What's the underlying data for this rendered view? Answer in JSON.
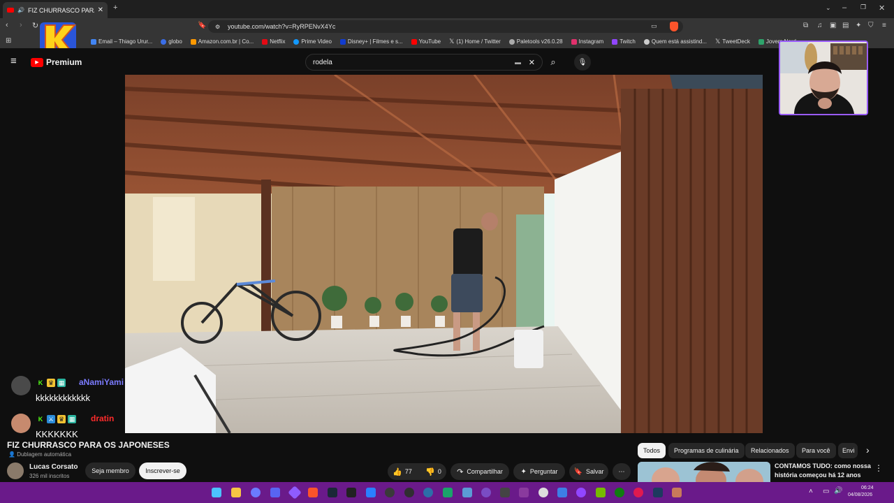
{
  "browser": {
    "tab_title": "FIZ CHURRASCO PARA OS JA",
    "url": "youtube.com/watch?v=RyRPENvX4Yc",
    "bookmarks": [
      {
        "label": "Email – Thiago Urur...",
        "color": "#4285f4"
      },
      {
        "label": "globo",
        "color": "#3a6ee8"
      },
      {
        "label": "Amazon.com.br | Co...",
        "color": "#ff9900"
      },
      {
        "label": "Netflix",
        "color": "#e50914"
      },
      {
        "label": "Prime Video",
        "color": "#1399ff"
      },
      {
        "label": "Disney+ | Filmes e s...",
        "color": "#113ccf"
      },
      {
        "label": "YouTube",
        "color": "#ff0000"
      },
      {
        "label": "(1) Home / Twitter",
        "color": "#ffffff"
      },
      {
        "label": "Paletools v26.0.28",
        "color": "#aaaaaa"
      },
      {
        "label": "Instagram",
        "color": "#e1306c"
      },
      {
        "label": "Twitch",
        "color": "#9146ff"
      },
      {
        "label": "Quem está assistind...",
        "color": "#cccccc"
      },
      {
        "label": "TweetDeck",
        "color": "#ffffff"
      },
      {
        "label": "Jovem Nerd -",
        "color": "#2ea36b"
      }
    ]
  },
  "youtube": {
    "logo_text": "Premium",
    "search_value": "rodela",
    "video": {
      "title": "FIZ CHURRASCO PARA OS JAPONESES",
      "dub_label": "Dublagem automática",
      "channel_name": "Lucas Corsato",
      "subscribers": "326 mil inscritos",
      "member_label": "Seja membro",
      "subscribe_label": "Inscrever-se",
      "likes": "77",
      "dislikes": "0",
      "share_label": "Compartilhar",
      "ask_label": "Perguntar",
      "save_label": "Salvar"
    },
    "chips": [
      "Todos",
      "Programas de culinária",
      "Relacionados",
      "Para você",
      "Envi"
    ],
    "recommended": {
      "title_line1": "CONTAMOS TUDO: como nossa",
      "title_line2": "história começou há 12 anos"
    }
  },
  "chat": [
    {
      "user": "aNamiYami",
      "message": "kkkkkkkkkkkk",
      "name_color": "#7b7bff"
    },
    {
      "user": "dratin",
      "message": "KKKKKKK",
      "name_color": "#ff2b2b"
    }
  ],
  "taskbar": {
    "time": "06:24",
    "date": "04/08/2026"
  }
}
